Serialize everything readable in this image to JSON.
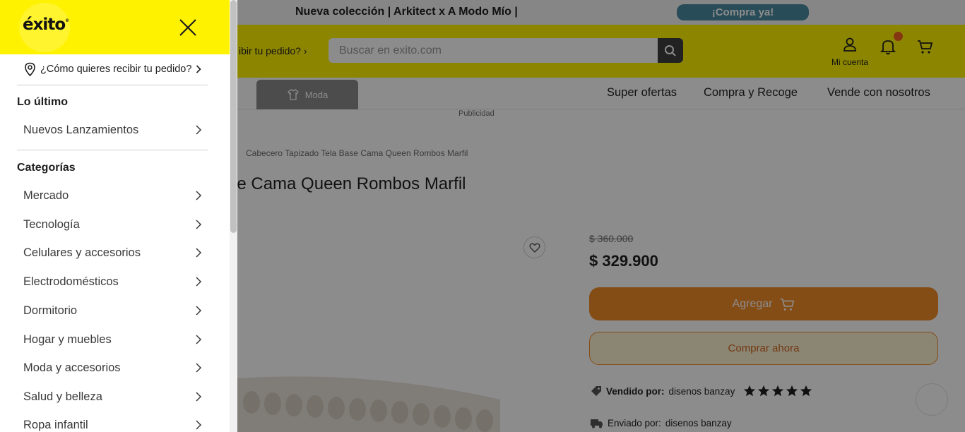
{
  "promo": {
    "text": "Nueva colección | Arkitect x A Modo Mío |",
    "button": "¡Compra ya!"
  },
  "header": {
    "delivery_snippet": "ibir tu pedido?",
    "search_placeholder": "Buscar en exito.com",
    "account_label": "Mi cuenta"
  },
  "nav": {
    "moda_tab": "Moda",
    "links": [
      "Super ofertas",
      "Compra y Recoge",
      "Vende con nosotros"
    ],
    "publicidad": "Publicidad"
  },
  "product": {
    "breadcrumb": "Cabecero Tapizado Tela Base Cama Queen Rombos Marfil",
    "title": "ase Cama Queen Rombos Marfil",
    "old_price": "$ 360.000",
    "price": "$ 329.900",
    "add_label": "Agregar",
    "buy_label": "Comprar ahora",
    "sold_by_label": "Vendido por:",
    "sold_by_value": "disenos banzay",
    "rating": 5,
    "shipped_by_label": "Enviado por:",
    "shipped_by_value": "disenos banzay"
  },
  "drawer": {
    "logo": "éxito",
    "location_text": "¿Cómo quieres recibir tu pedido?",
    "section_latest": "Lo último",
    "latest_items": [
      "Nuevos Lanzamientos"
    ],
    "section_categories": "Categorías",
    "categories": [
      "Mercado",
      "Tecnología",
      "Celulares y accesorios",
      "Electrodomésticos",
      "Dormitorio",
      "Hogar y muebles",
      "Moda y accesorios",
      "Salud y belleza",
      "Ropa infantil"
    ]
  },
  "colors": {
    "brand_yellow": "#fff200",
    "accent_orange": "#f28c28",
    "promo_button": "#4a8aa0"
  }
}
